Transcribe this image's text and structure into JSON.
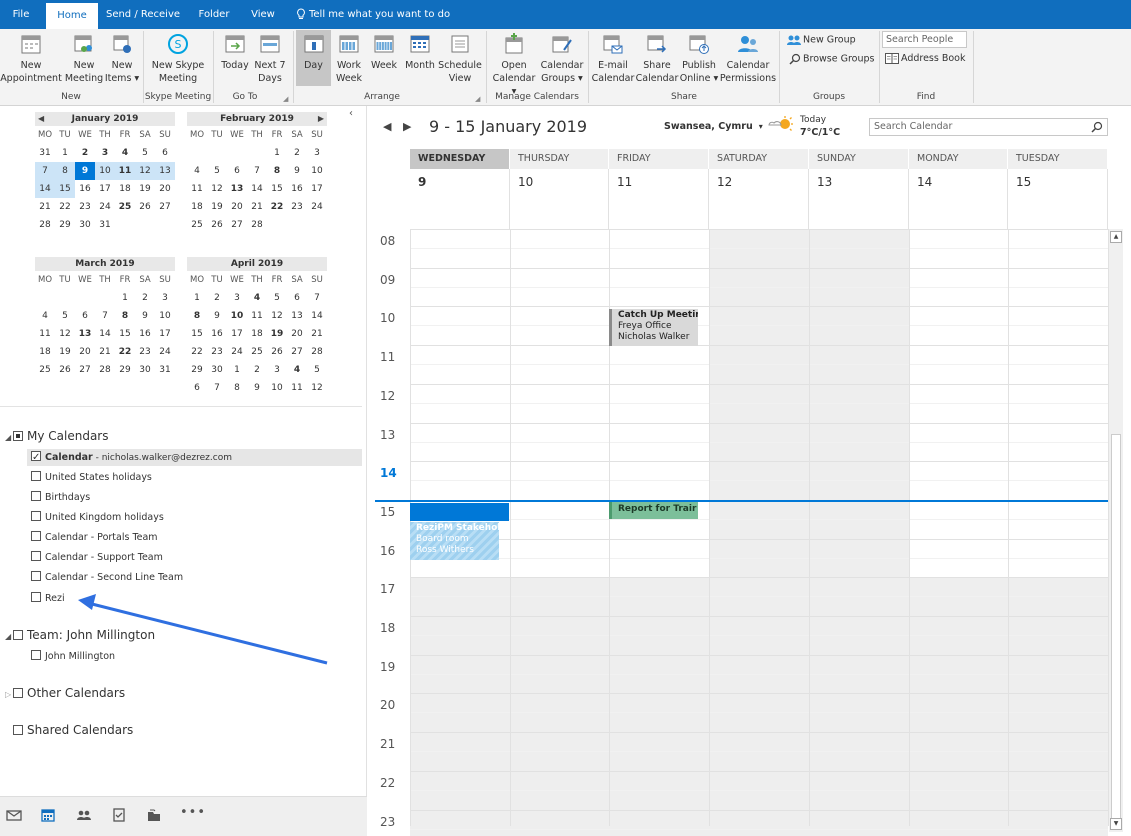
{
  "tabs": [
    "File",
    "Home",
    "Send / Receive",
    "Folder",
    "View"
  ],
  "tell_me": "Tell me what you want to do",
  "ribbon": {
    "new_appointment": [
      "New",
      "Appointment"
    ],
    "new_meeting": [
      "New",
      "Meeting"
    ],
    "new_items": [
      "New",
      "Items ▾"
    ],
    "new_skype_meeting": [
      "New Skype",
      "Meeting"
    ],
    "today": "Today",
    "next7": [
      "Next 7",
      "Days"
    ],
    "day": "Day",
    "work_week": [
      "Work",
      "Week"
    ],
    "week": "Week",
    "month": "Month",
    "schedule_view": [
      "Schedule",
      "View"
    ],
    "open_calendar": [
      "Open",
      "Calendar ▾"
    ],
    "calendar_groups": [
      "Calendar",
      "Groups ▾"
    ],
    "email_calendar": [
      "E-mail",
      "Calendar"
    ],
    "share_calendar": [
      "Share",
      "Calendar"
    ],
    "publish_online": [
      "Publish",
      "Online ▾"
    ],
    "calendar_permissions": [
      "Calendar",
      "Permissions"
    ],
    "new_group": "New Group",
    "browse_groups": "Browse Groups",
    "search_people": "Search People",
    "address_book": "Address Book",
    "groups": {
      "new": "New",
      "skype": "Skype Meeting",
      "goto": "Go To",
      "arrange": "Arrange",
      "manage": "Manage Calendars",
      "share": "Share",
      "groups": "Groups",
      "find": "Find"
    }
  },
  "weekday_abbr": [
    "MO",
    "TU",
    "WE",
    "TH",
    "FR",
    "SA",
    "SU"
  ],
  "minicals": [
    {
      "name": "January 2019",
      "weeks": [
        [
          "31",
          "1",
          "2",
          "3",
          "4",
          "5",
          "6"
        ],
        [
          "7",
          "8",
          "9",
          "10",
          "11",
          "12",
          "13"
        ],
        [
          "14",
          "15",
          "16",
          "17",
          "18",
          "19",
          "20"
        ],
        [
          "21",
          "22",
          "23",
          "24",
          "25",
          "26",
          "27"
        ],
        [
          "28",
          "29",
          "30",
          "31",
          "",
          "",
          ""
        ],
        [
          "",
          "",
          "",
          "",
          "",
          "",
          ""
        ]
      ],
      "bold": [
        "2",
        "3",
        "4",
        "11",
        "25"
      ],
      "selected": "9",
      "week_highlight": [
        1
      ]
    },
    {
      "name": "February 2019",
      "weeks": [
        [
          "",
          "",
          "",
          "",
          "1",
          "2",
          "3"
        ],
        [
          "4",
          "5",
          "6",
          "7",
          "8",
          "9",
          "10"
        ],
        [
          "11",
          "12",
          "13",
          "14",
          "15",
          "16",
          "17"
        ],
        [
          "18",
          "19",
          "20",
          "21",
          "22",
          "23",
          "24"
        ],
        [
          "25",
          "26",
          "27",
          "28",
          "",
          "",
          ""
        ],
        [
          "",
          "",
          "",
          "",
          "",
          "",
          ""
        ]
      ],
      "bold": [
        "8",
        "13",
        "22"
      ],
      "selected": "",
      "week_highlight": []
    },
    {
      "name": "March 2019",
      "weeks": [
        [
          "",
          "",
          "",
          "",
          "1",
          "2",
          "3"
        ],
        [
          "4",
          "5",
          "6",
          "7",
          "8",
          "9",
          "10"
        ],
        [
          "11",
          "12",
          "13",
          "14",
          "15",
          "16",
          "17"
        ],
        [
          "18",
          "19",
          "20",
          "21",
          "22",
          "23",
          "24"
        ],
        [
          "25",
          "26",
          "27",
          "28",
          "29",
          "30",
          "31"
        ],
        [
          "",
          "",
          "",
          "",
          "",
          "",
          ""
        ]
      ],
      "bold": [
        "8",
        "13",
        "22"
      ],
      "selected": "",
      "week_highlight": []
    },
    {
      "name": "April 2019",
      "weeks": [
        [
          "1",
          "2",
          "3",
          "4",
          "5",
          "6",
          "7"
        ],
        [
          "8",
          "9",
          "10",
          "11",
          "12",
          "13",
          "14"
        ],
        [
          "15",
          "16",
          "17",
          "18",
          "19",
          "20",
          "21"
        ],
        [
          "22",
          "23",
          "24",
          "25",
          "26",
          "27",
          "28"
        ],
        [
          "29",
          "30",
          "1",
          "2",
          "3",
          "4",
          "5"
        ],
        [
          "6",
          "7",
          "8",
          "9",
          "10",
          "11",
          "12"
        ]
      ],
      "bold": [
        "4",
        "10",
        "19",
        "8"
      ],
      "selected": "",
      "week_highlight": []
    }
  ],
  "folders": {
    "my_calendars": "My Calendars",
    "calendar_bold": "Calendar",
    "calendar_email": " - nicholas.walker@dezrez.com",
    "items": [
      "United States holidays",
      "Birthdays",
      "United Kingdom holidays",
      "Calendar - Portals Team",
      "Calendar - Support Team",
      "Calendar - Second Line Team",
      "Rezi"
    ],
    "team_group": "Team: John Millington",
    "team_item": "John Millington",
    "other_calendars": "Other Calendars",
    "shared_calendars": "Shared Calendars"
  },
  "calendar": {
    "date_range": "9 - 15 January 2019",
    "location": "Swansea, Cymru",
    "weather_today": "Today",
    "weather_temp": "7°C/1°C",
    "search_placeholder": "Search Calendar",
    "days": [
      {
        "name": "WEDNESDAY",
        "num": "9"
      },
      {
        "name": "THURSDAY",
        "num": "10"
      },
      {
        "name": "FRIDAY",
        "num": "11"
      },
      {
        "name": "SATURDAY",
        "num": "12"
      },
      {
        "name": "SUNDAY",
        "num": "13"
      },
      {
        "name": "MONDAY",
        "num": "14"
      },
      {
        "name": "TUESDAY",
        "num": "15"
      }
    ],
    "hours": [
      "08",
      "09",
      "10",
      "11",
      "12",
      "13",
      "14",
      "15",
      "16",
      "17",
      "18",
      "19",
      "20",
      "21",
      "22",
      "23"
    ],
    "events": {
      "catchup": {
        "title": "Catch Up Meeting",
        "loc": "Freya Office",
        "who": "Nicholas Walker"
      },
      "report": {
        "title": "Report for Trair"
      },
      "rezipm": {
        "title": "ReziPM Stakehole",
        "loc": "Board room",
        "who": "Ross Withers"
      }
    }
  },
  "colors": {
    "accent": "#0078d7",
    "tabbar": "#106ebe",
    "annotation_arrow": "#2f6fe0"
  }
}
